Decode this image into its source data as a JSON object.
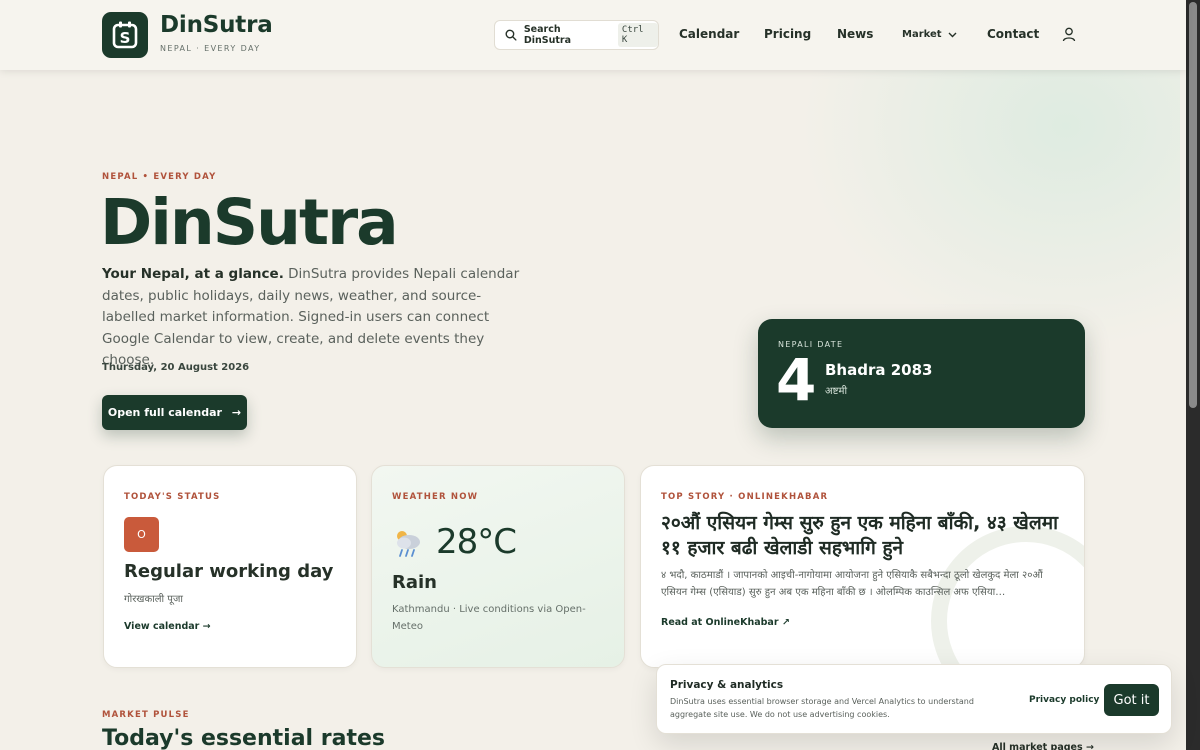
{
  "brand": {
    "name": "DinSutra",
    "tagline": "NEPAL · EVERY DAY",
    "logo_letter": "S"
  },
  "header": {
    "search_label": "Search DinSutra",
    "search_shortcut": "Ctrl K",
    "nav": {
      "calendar": "Calendar",
      "pricing": "Pricing",
      "news": "News",
      "market": "Market",
      "contact": "Contact"
    }
  },
  "hero": {
    "eyebrow": "NEPAL • EVERY DAY",
    "title": "DinSutra",
    "description_lead": "Your Nepal, at a glance.",
    "description_rest": " DinSutra provides Nepali calendar dates, public holidays, daily news, weather, and source-labelled market information. Signed-in users can connect Google Calendar to view, create, and delete events they choose.",
    "date": "Thursday, 20 August 2026",
    "cta_label": "Open full calendar",
    "cta_arrow": "→"
  },
  "nepali_date": {
    "label": "NEPALI DATE",
    "day": "4",
    "month_year": "Bhadra 2083",
    "subtitle": "अष्टमी"
  },
  "status_card": {
    "eyebrow": "TODAY'S STATUS",
    "badge": "O",
    "title": "Regular working day",
    "subtitle": "गोरखकाली पूजा",
    "link": "View calendar →"
  },
  "weather_card": {
    "eyebrow": "WEATHER NOW",
    "icon": "rain-cloud-icon",
    "temperature": "28°C",
    "condition": "Rain",
    "source": "Kathmandu · Live conditions via Open-Meteo"
  },
  "story_card": {
    "eyebrow": "TOP STORY · ONLINEKHABAR",
    "title": "२०औं एसियन गेम्स सुरु हुन एक महिना बाँकी, ४३ खेलमा ११ हजार बढी खेलाडी सहभागि हुने",
    "excerpt": "४ भदौ, काठमाडौं । जापानको आइची-नागोयामा आयोजना हुने एसियाकै सबैभन्दा ठूलो खेलकुद मेला २०औं एसियन गेम्स (एसियाड) सुरु हुन अब एक महिना बाँकी छ । ओलम्पिक काउन्सिल अफ एसिया…",
    "link": "Read at OnlineKhabar ↗"
  },
  "market": {
    "eyebrow": "MARKET PULSE",
    "title": "Today's essential rates",
    "all_link": "All market pages →"
  },
  "privacy": {
    "title": "Privacy & analytics",
    "body": "DinSutra uses essential browser storage and Vercel Analytics to understand aggregate site use. We do not use advertising cookies.",
    "link": "Privacy policy",
    "button": "Got it"
  },
  "colors": {
    "brand_green": "#1b3a2b",
    "accent_terracotta": "#b0523b",
    "background": "#f3f0e9"
  }
}
